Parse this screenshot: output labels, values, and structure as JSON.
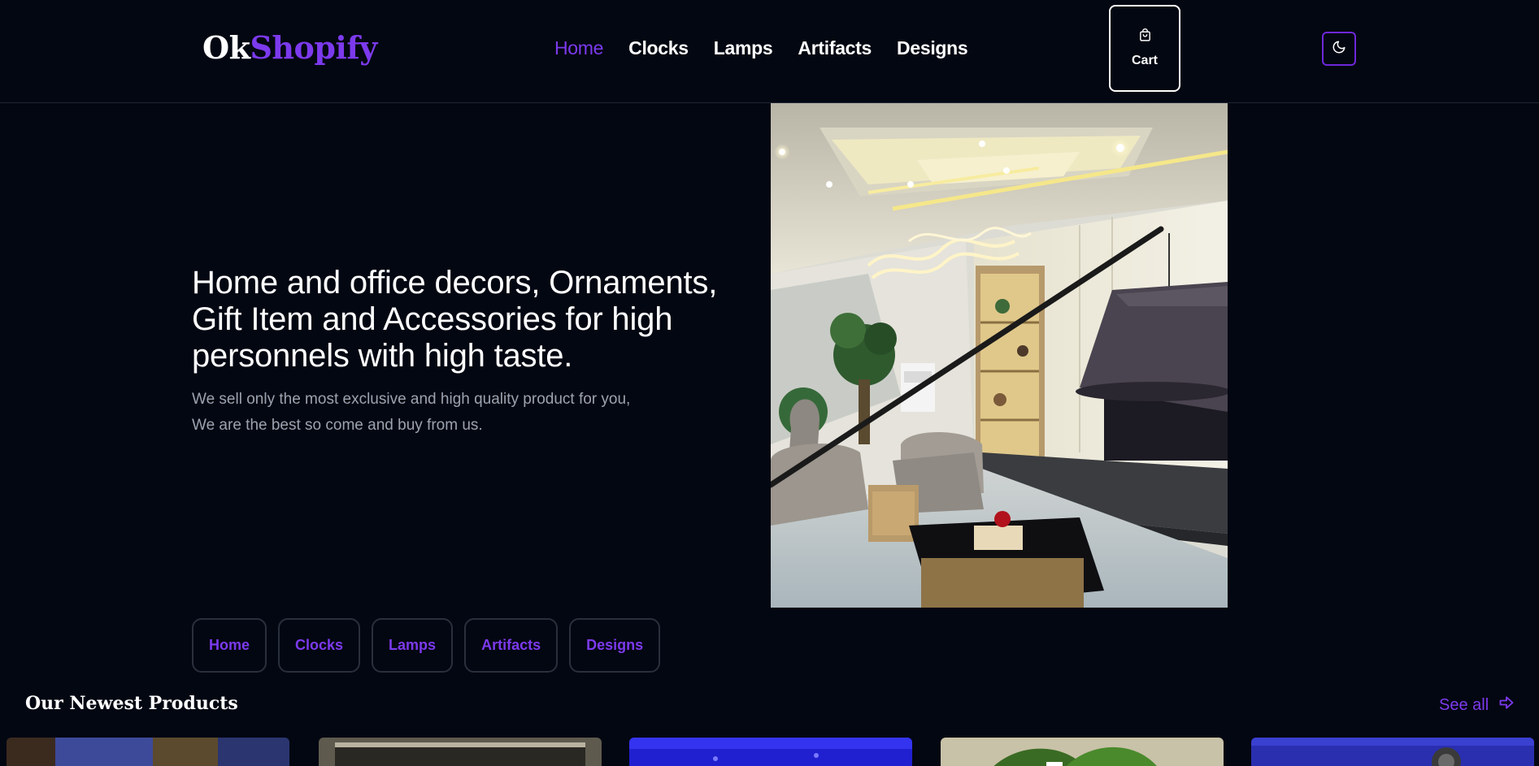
{
  "brand": {
    "part1": "Ok",
    "part2": "Shopify"
  },
  "nav": {
    "items": [
      "Home",
      "Clocks",
      "Lamps",
      "Artifacts",
      "Designs"
    ]
  },
  "cart": {
    "label": "Cart"
  },
  "hero": {
    "title": "Home and office decors, Ornaments, Gift Item and Accessories for high personnels with high taste.",
    "subtitle_line1": "We sell only the most exclusive and high quality product for you,",
    "subtitle_line2": "We are the best so come and buy from us."
  },
  "categories": [
    "Home",
    "Clocks",
    "Lamps",
    "Artifacts",
    "Designs"
  ],
  "newest": {
    "title": "Our Newest Products",
    "see_all": "See all"
  },
  "colors": {
    "background": "#030712",
    "accent": "#7c3aed",
    "muted_text": "#9ca3af"
  },
  "icons": {
    "cart": "shopping-bag-icon",
    "theme": "moon-icon",
    "see_all": "arrow-right-icon"
  }
}
